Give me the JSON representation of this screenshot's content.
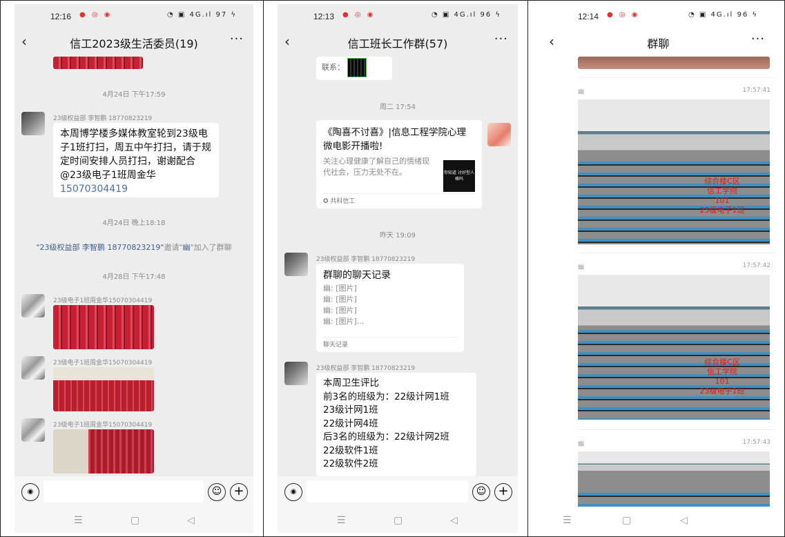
{
  "panel1": {
    "status": {
      "time": "12:16",
      "left_icons": "● ◎ ◉",
      "right_icons": "◔ ▣ 4G.ıl 97 ϟ"
    },
    "title": "信工2023级生活委员(19)",
    "timestamp1": "4月24日 下午17:59",
    "msg1": {
      "sender": "23级权益部 李智鹏 18770823219",
      "text": "本周博学楼多媒体教室轮到23级电子1班打扫，周五中午打扫，请于规定时间安排人员打扫，谢谢配合@23级电子1班周金华",
      "phone": "15070304419"
    },
    "timestamp2": "4月24日 晚上18:18",
    "system": {
      "inviter": "\"23级权益部 李智鹏 18770823219\"",
      "mid": "邀请\"",
      "invitee": "幽",
      "end": "\"加入了群聊"
    },
    "timestamp3": "4月28日 下午17:48",
    "img_sender": "23级电子1班周金华15070304419"
  },
  "panel2": {
    "status": {
      "time": "12:13",
      "left_icons": "● ◎ ◉",
      "right_icons": "◔ ▣ 4G.ıl 96 ϟ"
    },
    "title": "信工班长工作群(57)",
    "top_fragment": "联系：",
    "timestamp1": "周二 17:54",
    "card": {
      "title": "《陶喜不讨喜》|信息工程学院心理微电影开播啦!",
      "desc": "关注心理健康了解自己的情绪现代社会，压力无处不在。",
      "thumb_text": "你知道 讨好型人格吗",
      "source": "共科信工"
    },
    "timestamp2": "昨天 19:09",
    "sender": "23级权益部 李智鹏 18770823219",
    "record": {
      "title": "群聊的聊天记录",
      "lines": [
        "幽: [图片]",
        "幽: [图片]",
        "幽: [图片]",
        "幽: [图片]..."
      ],
      "footer": "聊天记录"
    },
    "msg2": {
      "lines": [
        "本周卫生评比",
        "前3名的班级为：22级计网1班",
        "23级计网1班",
        "22级计网4班",
        "后3名的班级为：22级计网2班",
        "22级软件1班",
        "22级软件2班"
      ]
    }
  },
  "panel3": {
    "status": {
      "time": "12:14",
      "left_icons": "● ◎ ◉",
      "right_icons": "◔ ▣ 4G.ıl 96 ϟ"
    },
    "title": "群聊",
    "images": [
      {
        "author": "幽",
        "time": "17:57:41",
        "overlay": [
          "综合楼C区",
          "信工学院",
          "101",
          "23级电子1班"
        ]
      },
      {
        "author": "幽",
        "time": "17:57:42",
        "overlay": [
          "综合楼C区",
          "信工学院",
          "101",
          "23级电子1班"
        ]
      },
      {
        "author": "幽",
        "time": "17:57:43"
      }
    ]
  },
  "ui": {
    "back": "‹",
    "more": "···",
    "voice": "◉",
    "emoji": "☺",
    "plus": "+",
    "nav": [
      "☰",
      "▢",
      "◁"
    ]
  }
}
